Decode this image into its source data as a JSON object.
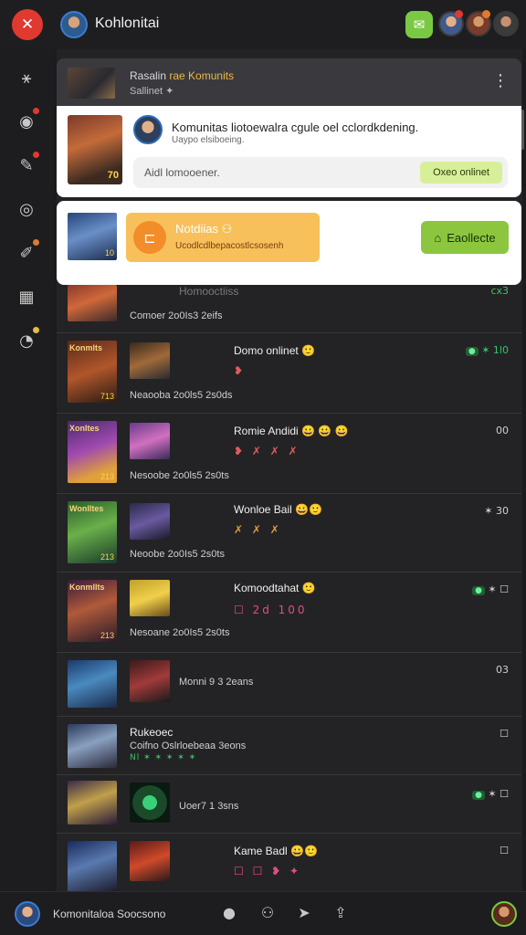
{
  "topbar": {
    "title": "Kohlonitai",
    "chat_icon": "chat-bubble-icon",
    "accent": "#7ac943",
    "logo_color": "#e0392f"
  },
  "head_card": {
    "title_prefix": "Rasalin",
    "title_accent": "rae Komunits",
    "subtitle": "Sallinet ✦"
  },
  "compose": {
    "headline": "Komunitas liotoewalra cgule oel cclordkdening.",
    "subline": "Uaypo elsiboeing.",
    "placeholder": "Aidl lomooener.",
    "post_button": "Oxeo onlinet",
    "thumb_number": "70"
  },
  "notification": {
    "title": "Notdiias ⚇",
    "subtitle": "Ucodlcdlbepacostlcsosenh",
    "action_button": "Eaollecte",
    "thumb_number": "10"
  },
  "feed": [
    {
      "thumb_label": "",
      "thumb_number": "",
      "name": "Homooctiiss",
      "emojis": "",
      "meta": "Comoer 2o0Is3 2eifs",
      "right": "cx3"
    },
    {
      "thumb_label": "Konmlts",
      "thumb_number": "713",
      "name": "Domo onlinet 🙂",
      "emojis": "❥",
      "meta": "Neaooba 2o0ls5 2s0ds",
      "right": "✶ 1l0"
    },
    {
      "thumb_label": "Xonltes",
      "thumb_number": "213",
      "name": "Romie Andidi 😀 😀 😀",
      "emojis": "❥ ✗ ✗ ✗",
      "meta": "Nesoobe 2o0ls5 2s0ts",
      "right": "00"
    },
    {
      "thumb_label": "Wonlltes",
      "thumb_number": "213",
      "name": "Wonloe Bail 😀🙂",
      "emojis": "✗ ✗ ✗",
      "meta": "Neoobe 2o0Is5 2s0ts",
      "right": "✶ 30"
    },
    {
      "thumb_label": "Konmllts",
      "thumb_number": "213",
      "name": "Komoodtahat 🙂",
      "emojis": "☐ 2d 100",
      "meta": "Nesoane 2o0Is5 2s0ts",
      "right": "✶ ☐"
    },
    {
      "thumb_label": "",
      "thumb_number": "",
      "name": "",
      "emojis": "",
      "meta": "Monni 9 3 2eans",
      "right": "03"
    },
    {
      "thumb_label": "",
      "thumb_number": "",
      "name": "Rukeoec",
      "emojis": "Nl ✶ ✶ ✶ ✶ ✶",
      "meta": "Coifno  Oslrloebeaa 3eons",
      "right": "☐"
    },
    {
      "thumb_label": "",
      "thumb_number": "",
      "name": "",
      "emojis": "",
      "meta": "Uoer7 1 3sns",
      "right": "✶ ☐"
    },
    {
      "thumb_label": "",
      "thumb_number": "",
      "name": "Kame Badl 😀🙂",
      "emojis": "☐ ☐ ❥ ✦",
      "meta": "",
      "right": "☐"
    }
  ],
  "bottombar": {
    "status_text": "Komonitaloa Soocsono",
    "icons": [
      "person-icon",
      "group-icon",
      "send-icon",
      "share-icon"
    ]
  }
}
